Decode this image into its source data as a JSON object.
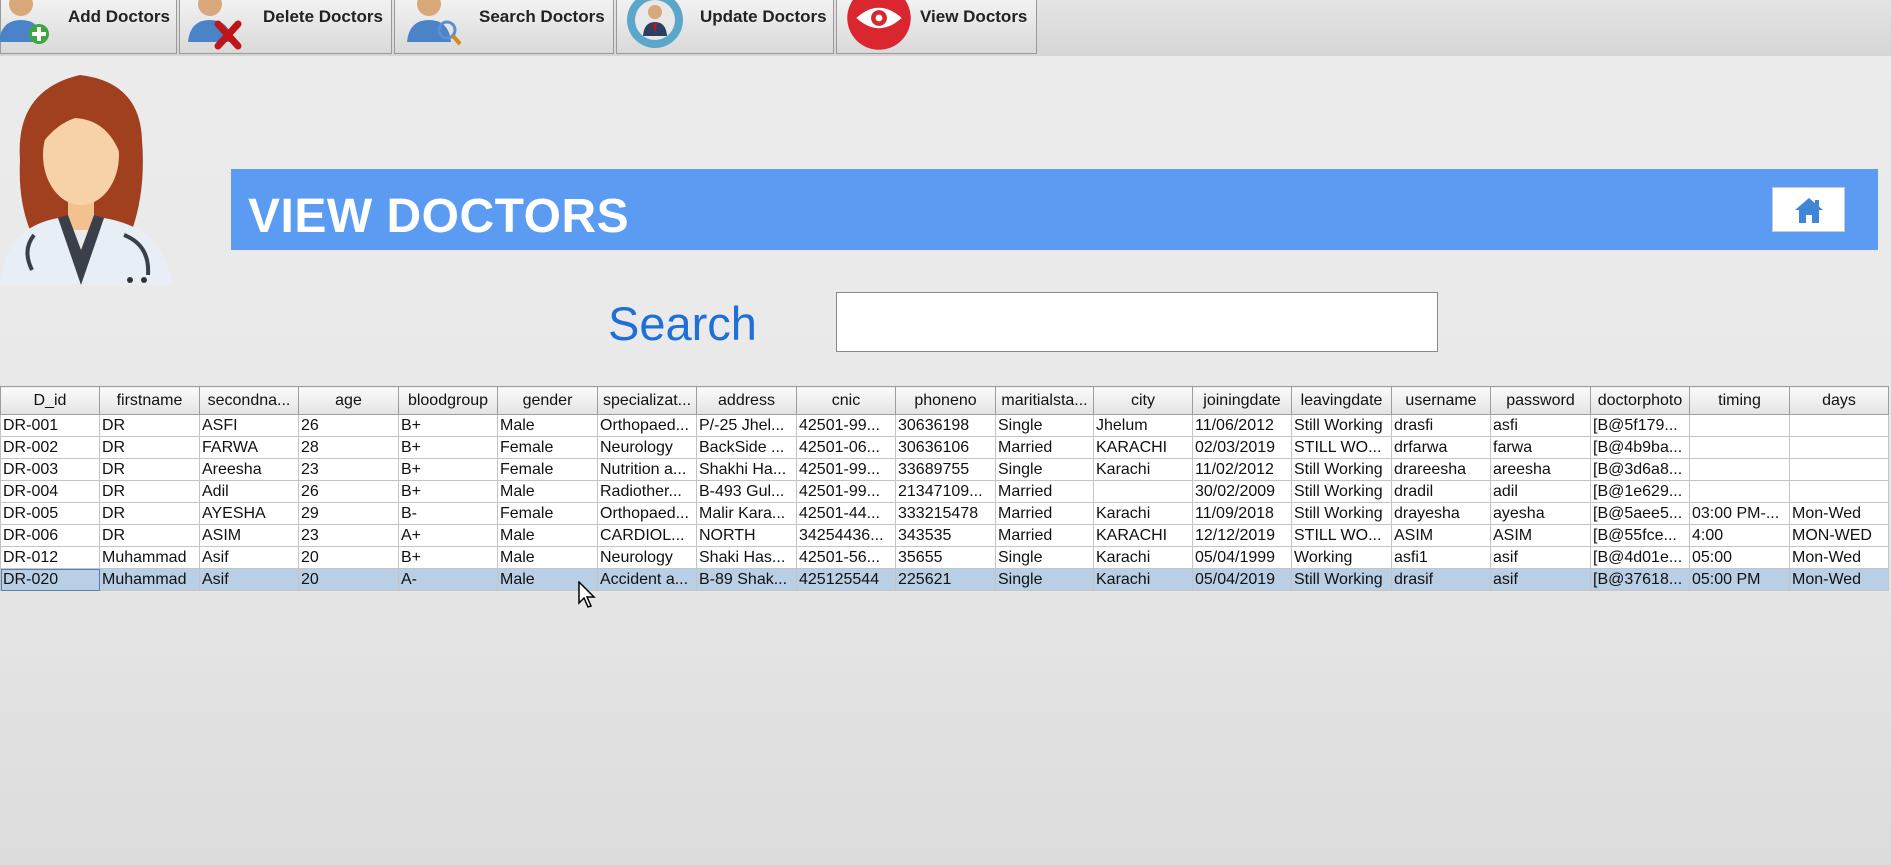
{
  "toolbar": {
    "buttons": [
      {
        "label": "Add Doctors",
        "icon": "add-doctor-icon"
      },
      {
        "label": "Delete Doctors",
        "icon": "delete-doctor-icon"
      },
      {
        "label": "Search Doctors",
        "icon": "search-doctor-icon"
      },
      {
        "label": "Update Doctors",
        "icon": "update-doctor-icon"
      },
      {
        "label": "View Doctors",
        "icon": "eye-icon"
      }
    ]
  },
  "banner": {
    "title": "VIEW DOCTORS",
    "home_icon": "home-icon",
    "color": "#5b9bf2"
  },
  "search": {
    "label": "Search",
    "value": "",
    "placeholder": ""
  },
  "table": {
    "headers": [
      "D_id",
      "firstname",
      "secondna...",
      "age",
      "bloodgroup",
      "gender",
      "specializat...",
      "address",
      "cnic",
      "phoneno",
      "maritialsta...",
      "city",
      "joiningdate",
      "leavingdate",
      "username",
      "password",
      "doctorphoto",
      "timing",
      "days"
    ],
    "rows": [
      [
        "DR-001",
        "DR",
        "ASFI",
        "26",
        "B+",
        "Male",
        "Orthopaed...",
        "P/-25 Jhel...",
        "42501-99...",
        "30636198",
        "Single",
        "Jhelum",
        "11/06/2012",
        "Still Working",
        "drasfi",
        "asfi",
        "[B@5f179...",
        "",
        ""
      ],
      [
        "DR-002",
        "DR",
        "FARWA",
        "28",
        "B+",
        "Female",
        "Neurology",
        "BackSide ...",
        "42501-06...",
        "30636106",
        "Married",
        "KARACHI",
        "02/03/2019",
        "STILL WO...",
        "drfarwa",
        "farwa",
        "[B@4b9ba...",
        "",
        ""
      ],
      [
        "DR-003",
        "DR",
        "Areesha",
        "23",
        "B+",
        "Female",
        "Nutrition a...",
        "Shakhi Ha...",
        "42501-99...",
        "33689755",
        "Single",
        "Karachi",
        "11/02/2012",
        "Still Working",
        "drareesha",
        "areesha",
        "[B@3d6a8...",
        "",
        ""
      ],
      [
        "DR-004",
        "DR",
        "Adil",
        "26",
        "B+",
        "Male",
        "Radiother...",
        "B-493 Gul...",
        "42501-99...",
        "21347109...",
        "Married",
        "",
        "30/02/2009",
        "Still Working",
        "dradil",
        "adil",
        "[B@1e629...",
        "",
        ""
      ],
      [
        "DR-005",
        "DR",
        "AYESHA",
        "29",
        "B-",
        "Female",
        "Orthopaed...",
        "Malir Kara...",
        "42501-44...",
        "333215478",
        "Married",
        "Karachi",
        "11/09/2018",
        "Still Working",
        "drayesha",
        "ayesha",
        "[B@5aee5...",
        "03:00 PM-...",
        "Mon-Wed"
      ],
      [
        "DR-006",
        "DR",
        "ASIM",
        "23",
        "A+",
        "Male",
        "CARDIOL...",
        "NORTH",
        "34254436...",
        "343535",
        "Married",
        "KARACHI",
        "12/12/2019",
        "STILL WO...",
        "ASIM",
        "ASIM",
        "[B@55fce...",
        "4:00",
        "MON-WED"
      ],
      [
        "DR-012",
        "Muhammad",
        "Asif",
        "20",
        "B+",
        "Male",
        "Neurology",
        "Shaki Has...",
        "42501-56...",
        "35655",
        "Single",
        "Karachi",
        "05/04/1999",
        "Working",
        "asfi1",
        "asif",
        "[B@4d01e...",
        "05:00",
        "Mon-Wed"
      ],
      [
        "DR-020",
        "Muhammad",
        "Asif",
        "20",
        "A-",
        "Male",
        "Accident a...",
        "B-89 Shak...",
        "425125544",
        "225621",
        "Single",
        "Karachi",
        "05/04/2019",
        "Still Working",
        "drasif",
        "asif",
        "[B@37618...",
        "05:00 PM",
        "Mon-Wed"
      ]
    ],
    "selected_row": 7
  }
}
